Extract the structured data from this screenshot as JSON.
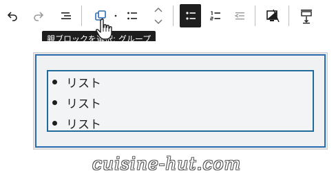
{
  "toolbar": {
    "buttons": [
      {
        "name": "undo",
        "icon": "undo-icon"
      },
      {
        "name": "redo",
        "icon": "redo-icon"
      },
      {
        "name": "document-overview",
        "icon": "list-view-icon"
      },
      {
        "name": "select-parent",
        "icon": "parent-block-icon"
      },
      {
        "name": "drag",
        "icon": "drag-handle-icon"
      },
      {
        "name": "block-mover",
        "icon": "chevron-up-down-icon"
      },
      {
        "name": "unordered-list",
        "icon": "bulleted-list-icon"
      },
      {
        "name": "ordered-list",
        "icon": "numbered-list-icon"
      },
      {
        "name": "outdent",
        "icon": "outdent-icon"
      },
      {
        "name": "color",
        "icon": "color-fill-icon"
      },
      {
        "name": "spacing",
        "icon": "vertical-spacing-icon"
      }
    ],
    "accent_active": "#1e1e1e"
  },
  "tooltip": {
    "text": "親ブロックを選択: グループ"
  },
  "list": {
    "items": [
      "リスト",
      "リスト",
      "リスト"
    ]
  },
  "colors": {
    "selected_border": "#1f6a9a",
    "group_border": "#2a6bb0"
  },
  "watermark": {
    "text": "cuisine-hut.com"
  }
}
